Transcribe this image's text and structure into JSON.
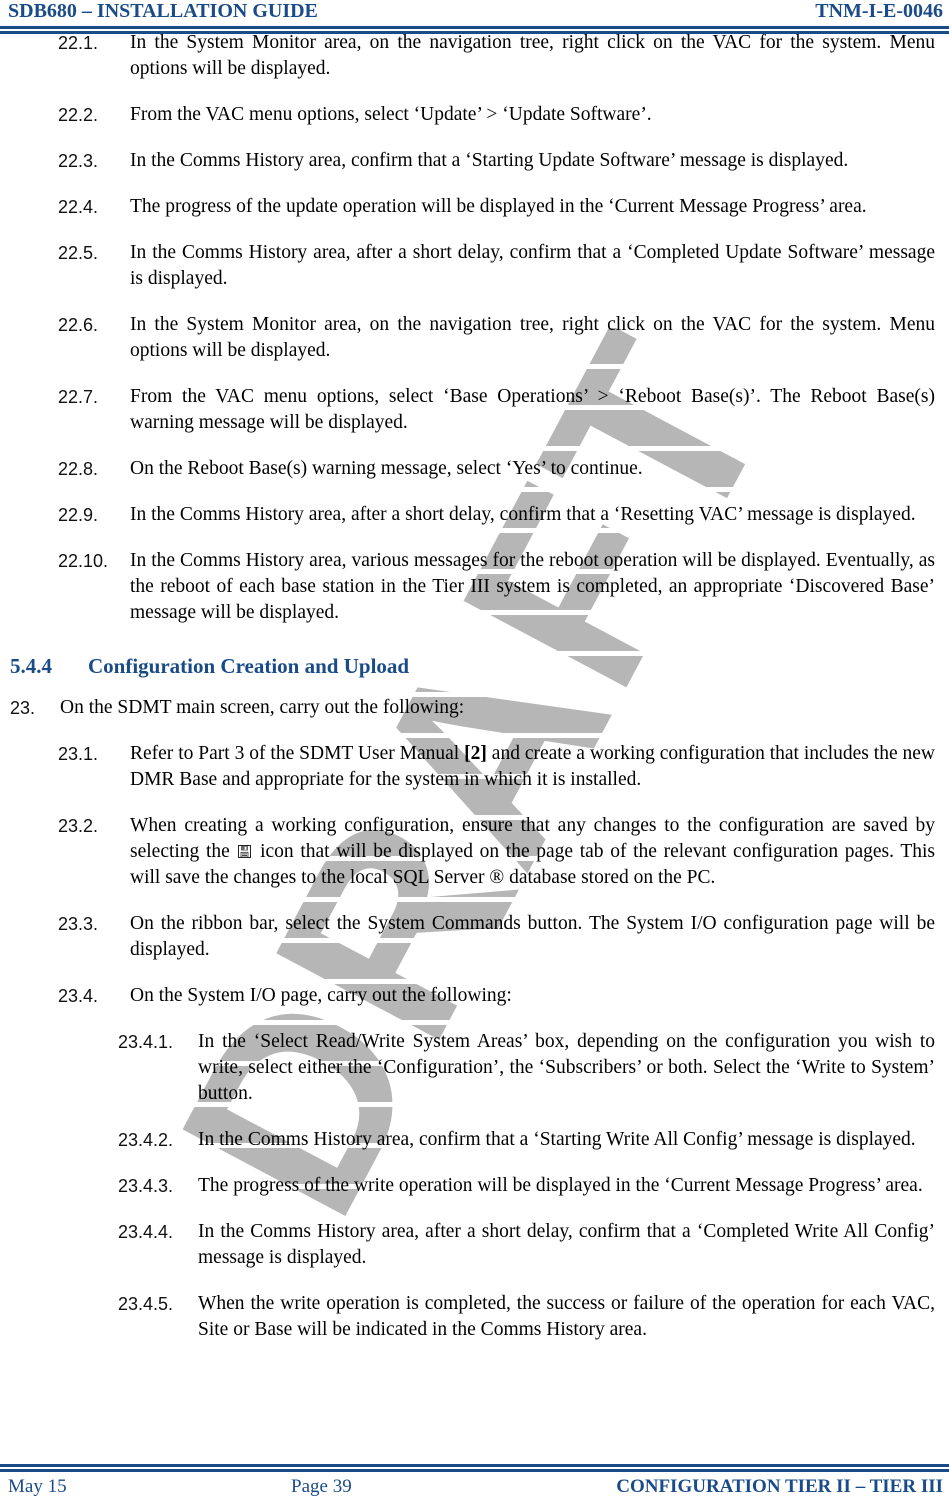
{
  "header": {
    "left": "SDB680 – INSTALLATION GUIDE",
    "right": "TNM-I-E-0046"
  },
  "footer": {
    "left": "May 15",
    "center": "Page 39",
    "right": "CONFIGURATION TIER II – TIER III"
  },
  "watermark": {
    "text": "DRAFT",
    "color": "#b6b6b6"
  },
  "theme": {
    "accent_blue": "#1a4b89",
    "rule_blue": "#1a4b89"
  },
  "items": {
    "i22_1": {
      "num": "22.1.",
      "text": "In the System Monitor area, on the navigation tree, right click on the VAC for the system.  Menu options will be displayed."
    },
    "i22_2": {
      "num": "22.2.",
      "text": "From the VAC menu options, select ‘Update’ > ‘Update Software’."
    },
    "i22_3": {
      "num": "22.3.",
      "text": "In the Comms History area, confirm that a ‘Starting Update Software’ message is displayed."
    },
    "i22_4": {
      "num": "22.4.",
      "text": "The progress of the update operation will be displayed in the ‘Current Message Progress’ area."
    },
    "i22_5": {
      "num": "22.5.",
      "text": "In the Comms History area, after a short delay, confirm that a ‘Completed Update Software’ message is displayed."
    },
    "i22_6": {
      "num": "22.6.",
      "text": "In the System Monitor area, on the navigation tree, right click on the VAC for the system.  Menu options will be displayed."
    },
    "i22_7": {
      "num": "22.7.",
      "text": "From the VAC menu options, select ‘Base Operations’ > ‘Reboot Base(s)’.   The Reboot Base(s) warning message will be displayed."
    },
    "i22_8": {
      "num": "22.8.",
      "text": "On the Reboot Base(s) warning message, select ‘Yes’ to continue."
    },
    "i22_9": {
      "num": "22.9.",
      "text": "In the Comms History area, after a short delay, confirm that a ‘Resetting VAC’ message is displayed."
    },
    "i22_10": {
      "num": "22.10.",
      "text": "In the Comms History area, various messages for the reboot operation will be displayed.  Eventually, as the reboot of each base station in the Tier III system is completed, an appropriate ‘Discovered Base’ message will be displayed."
    },
    "i23": {
      "num": "23.",
      "text": "On the SDMT main screen, carry out the following:"
    },
    "i23_1": {
      "num": "23.1.",
      "text_before": "Refer to Part 3 of the SDMT User Manual ",
      "reference": "[2]",
      "text_after": " and create a working configuration that includes the new DMR Base and appropriate for the system in which it is installed."
    },
    "i23_2": {
      "num": "23.2.",
      "text_before": "When creating a working configuration, ensure that any changes to the configuration are saved by selecting the ",
      "icon": "save-icon",
      "text_after": " icon that will be displayed on the page tab of the relevant configuration pages.  This will save the changes to the local SQL Server ® database stored on the PC."
    },
    "i23_3": {
      "num": "23.3.",
      "text": "On the ribbon bar, select the System Commands button.  The System I/O configuration page will be displayed."
    },
    "i23_4": {
      "num": "23.4.",
      "text": "On the System I/O page, carry out the following:"
    },
    "i23_4_1": {
      "num": "23.4.1.",
      "text": "In the ‘Select Read/Write System Areas’ box, depending on the configuration you wish to write, select either the ‘Configuration’, the ‘Subscribers’ or both.  Select the ‘Write to System’ button."
    },
    "i23_4_2": {
      "num": "23.4.2.",
      "text": "In the Comms History area, confirm that a ‘Starting Write All Config’ message is displayed."
    },
    "i23_4_3": {
      "num": "23.4.3.",
      "text": "The progress of the write operation will be displayed in the ‘Current Message Progress’ area."
    },
    "i23_4_4": {
      "num": "23.4.4.",
      "text": "In the Comms History area, after a short delay, confirm that a ‘Completed Write All Config’ message is displayed."
    },
    "i23_4_5": {
      "num": "23.4.5.",
      "text": "When the write operation is completed, the success or failure of the operation for each VAC, Site or Base will be indicated in the Comms History area."
    }
  },
  "section": {
    "number": "5.4.4",
    "title": "Configuration Creation and Upload"
  }
}
